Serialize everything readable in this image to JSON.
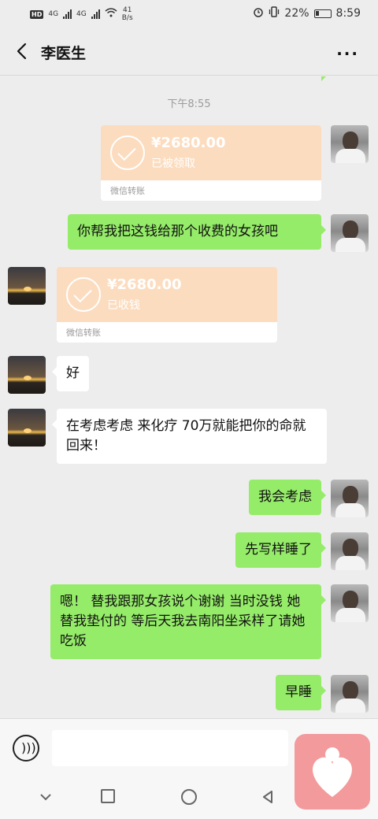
{
  "status_bar": {
    "left": {
      "hd": "HD",
      "net1": "4G",
      "net2": "4G",
      "speed_value": "41",
      "speed_unit": "B/s"
    },
    "right": {
      "battery_pct": "22%",
      "time": "8:59"
    }
  },
  "header": {
    "title": "李医生",
    "more_glyph": "···"
  },
  "messages": {
    "time_divider": "下午8:55",
    "transfer_1": {
      "amount": "¥2680.00",
      "status": "已被领取",
      "footer": "微信转账"
    },
    "msg_1": "你帮我把这钱给那个收费的女孩吧",
    "transfer_2": {
      "amount": "¥2680.00",
      "status": "已收钱",
      "footer": "微信转账"
    },
    "msg_2": "好",
    "msg_3": "在考虑考虑  来化疗  70万就能把你的命就回来！",
    "msg_4": "我会考虑",
    "msg_5": "先写样睡了",
    "msg_6": "嗯！  替我跟那女孩说个谢谢  当时没钱 她替我垫付的  等后天我去南阳坐采样了请她吃饭",
    "msg_7": "早睡"
  },
  "colors": {
    "chat_bg": "#ededed",
    "my_bubble": "#95ec69",
    "their_bubble": "#ffffff",
    "transfer": "#fcdcbf"
  },
  "icons": [
    "back-icon",
    "more-icon",
    "voice-icon",
    "nav-down-icon",
    "nav-home-icon",
    "nav-back-icon",
    "nav-recents-icon"
  ]
}
